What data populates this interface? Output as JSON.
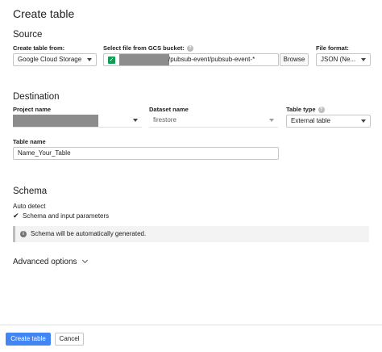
{
  "page_title": "Create table",
  "source": {
    "section_title": "Source",
    "create_from_label": "Create table from:",
    "create_from_value": "Google Cloud Storage",
    "gcs_label": "Select file from GCS bucket:",
    "gcs_path": "/pubsub-event/pubsub-event-*",
    "browse_label": "Browse",
    "file_format_label": "File format:",
    "file_format_value": "JSON (Ne..."
  },
  "destination": {
    "section_title": "Destination",
    "project_label": "Project name",
    "dataset_label": "Dataset name",
    "dataset_value": "firestore",
    "table_type_label": "Table type",
    "table_type_value": "External table",
    "table_name_label": "Table name",
    "table_name_value": "Name_Your_Table"
  },
  "schema": {
    "section_title": "Schema",
    "auto_detect_label": "Auto detect",
    "checkbox_label": "Schema and input parameters",
    "checkbox_checked": true,
    "info_text": "Schema will be automatically generated."
  },
  "advanced_label": "Advanced options",
  "footer": {
    "create_label": "Create table",
    "cancel_label": "Cancel"
  },
  "colors": {
    "primary": "#4285f4",
    "check_green": "#0f9d58",
    "redaction": "#8c8c8c"
  }
}
